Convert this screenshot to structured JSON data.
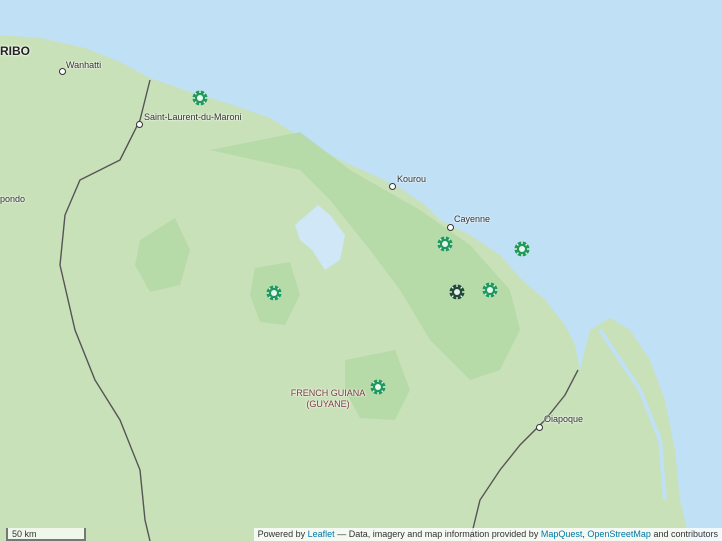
{
  "map": {
    "places": {
      "paramaribo": "RIBO",
      "wanhatti": "Wanhatti",
      "saint_laurent": "Saint-Laurent-du-Maroni",
      "apondo": "pondo",
      "kourou": "Kourou",
      "cayenne": "Cayenne",
      "oiapoque": "Oiapoque",
      "region_line1": "FRENCH GUIANA",
      "region_line2": "(GUYANE)"
    },
    "markers": [
      {
        "name": "Saint-Laurent marker",
        "icon": "turtle-icon",
        "color": "#1f9a5b"
      },
      {
        "name": "Cayenne west marker",
        "icon": "turtle-icon",
        "color": "#1f9a5b"
      },
      {
        "name": "Offshore marker",
        "icon": "turtle-icon",
        "color": "#1f9a5b"
      },
      {
        "name": "Central marker",
        "icon": "turtle-icon",
        "color": "#1f9a5b"
      },
      {
        "name": "Selected marker",
        "icon": "turtle-icon",
        "color": "#1e4d34"
      },
      {
        "name": "East marker",
        "icon": "turtle-icon",
        "color": "#1f9a5b"
      },
      {
        "name": "South marker",
        "icon": "turtle-icon",
        "color": "#1f9a5b"
      }
    ],
    "scale": {
      "label": "50 km"
    },
    "attribution": {
      "powered_by": "Powered by",
      "leaflet": "Leaflet",
      "sep": "—",
      "data_text": "Data, imagery and map information provided by",
      "mapquest": "MapQuest",
      "osm": "OpenStreetMap",
      "suffix": "and contributors"
    },
    "colors": {
      "sea": "#bfe0f5",
      "land": "#c9e1b9",
      "protected_area": "#b1d8a4",
      "border": "#555555",
      "marker": "#1f9a5b",
      "marker_selected": "#1e4d34"
    }
  }
}
